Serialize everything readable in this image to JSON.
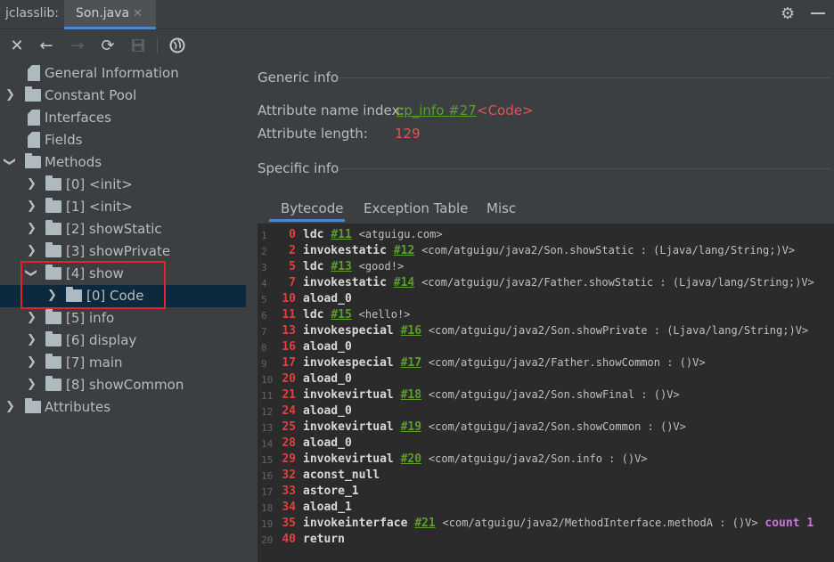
{
  "title_bar": {
    "app_label": "jclasslib:",
    "tab_label": "Son.java",
    "tab_close": "✕"
  },
  "toolbar": {
    "icons": [
      "close-icon",
      "back-icon",
      "forward-icon",
      "refresh-icon",
      "save-icon",
      "web-icon"
    ]
  },
  "tree": {
    "nodes": [
      {
        "label": "General Information",
        "expandable": false,
        "kind": "doc"
      },
      {
        "label": "Constant Pool",
        "expandable": true,
        "kind": "folder"
      },
      {
        "label": "Interfaces",
        "expandable": false,
        "kind": "doc"
      },
      {
        "label": "Fields",
        "expandable": false,
        "kind": "doc"
      },
      {
        "label": "Methods",
        "expandable": true,
        "expanded": true,
        "kind": "folder"
      },
      {
        "label": "[0] <init>"
      },
      {
        "label": "[1] <init>"
      },
      {
        "label": "[2] showStatic"
      },
      {
        "label": "[3] showPrivate"
      },
      {
        "label": "[4] show",
        "expanded": true
      },
      {
        "label": "[0] Code",
        "selected": true
      },
      {
        "label": "[5] info"
      },
      {
        "label": "[6] display"
      },
      {
        "label": "[7] main"
      },
      {
        "label": "[8] showCommon"
      },
      {
        "label": "Attributes",
        "expandable": true,
        "kind": "folder"
      }
    ]
  },
  "generic_info": {
    "heading": "Generic info",
    "name_index_label": "Attribute name index:",
    "name_index_link": "cp_info #27",
    "name_index_value": "<Code>",
    "length_label": "Attribute length:",
    "length_value": "129"
  },
  "specific_info": {
    "heading": "Specific info",
    "tabs": [
      "Bytecode",
      "Exception Table",
      "Misc"
    ],
    "active_tab": "Bytecode"
  },
  "bytecode": [
    {
      "ln": "1",
      "off": "0",
      "op": "ldc",
      "ref": "#11",
      "cmt": "<atguigu.com>"
    },
    {
      "ln": "2",
      "off": "2",
      "op": "invokestatic",
      "ref": "#12",
      "cmt": "<com/atguigu/java2/Son.showStatic : (Ljava/lang/String;)V>"
    },
    {
      "ln": "3",
      "off": "5",
      "op": "ldc",
      "ref": "#13",
      "cmt": "<good!>"
    },
    {
      "ln": "4",
      "off": "7",
      "op": "invokestatic",
      "ref": "#14",
      "cmt": "<com/atguigu/java2/Father.showStatic : (Ljava/lang/String;)V>"
    },
    {
      "ln": "5",
      "off": "10",
      "op": "aload_0",
      "ref": "",
      "cmt": ""
    },
    {
      "ln": "6",
      "off": "11",
      "op": "ldc",
      "ref": "#15",
      "cmt": "<hello!>"
    },
    {
      "ln": "7",
      "off": "13",
      "op": "invokespecial",
      "ref": "#16",
      "cmt": "<com/atguigu/java2/Son.showPrivate : (Ljava/lang/String;)V>"
    },
    {
      "ln": "8",
      "off": "16",
      "op": "aload_0",
      "ref": "",
      "cmt": ""
    },
    {
      "ln": "9",
      "off": "17",
      "op": "invokespecial",
      "ref": "#17",
      "cmt": "<com/atguigu/java2/Father.showCommon : ()V>"
    },
    {
      "ln": "10",
      "off": "20",
      "op": "aload_0",
      "ref": "",
      "cmt": ""
    },
    {
      "ln": "11",
      "off": "21",
      "op": "invokevirtual",
      "ref": "#18",
      "cmt": "<com/atguigu/java2/Son.showFinal : ()V>"
    },
    {
      "ln": "12",
      "off": "24",
      "op": "aload_0",
      "ref": "",
      "cmt": ""
    },
    {
      "ln": "13",
      "off": "25",
      "op": "invokevirtual",
      "ref": "#19",
      "cmt": "<com/atguigu/java2/Son.showCommon : ()V>"
    },
    {
      "ln": "14",
      "off": "28",
      "op": "aload_0",
      "ref": "",
      "cmt": ""
    },
    {
      "ln": "15",
      "off": "29",
      "op": "invokevirtual",
      "ref": "#20",
      "cmt": "<com/atguigu/java2/Son.info : ()V>"
    },
    {
      "ln": "16",
      "off": "32",
      "op": "aconst_null",
      "ref": "",
      "cmt": ""
    },
    {
      "ln": "17",
      "off": "33",
      "op": "astore_1",
      "ref": "",
      "cmt": ""
    },
    {
      "ln": "18",
      "off": "34",
      "op": "aload_1",
      "ref": "",
      "cmt": ""
    },
    {
      "ln": "19",
      "off": "35",
      "op": "invokeinterface",
      "ref": "#21",
      "cmt": "<com/atguigu/java2/MethodInterface.methodA : ()V>",
      "extra_kw": "count",
      "extra_val": "1"
    },
    {
      "ln": "20",
      "off": "40",
      "op": "return",
      "ref": "",
      "cmt": ""
    }
  ],
  "colors": {
    "accent": "#4a88c7",
    "selection": "#0d293e",
    "highlight_box": "#e0242b",
    "offset": "#e04040",
    "link": "#5d9e2e"
  }
}
